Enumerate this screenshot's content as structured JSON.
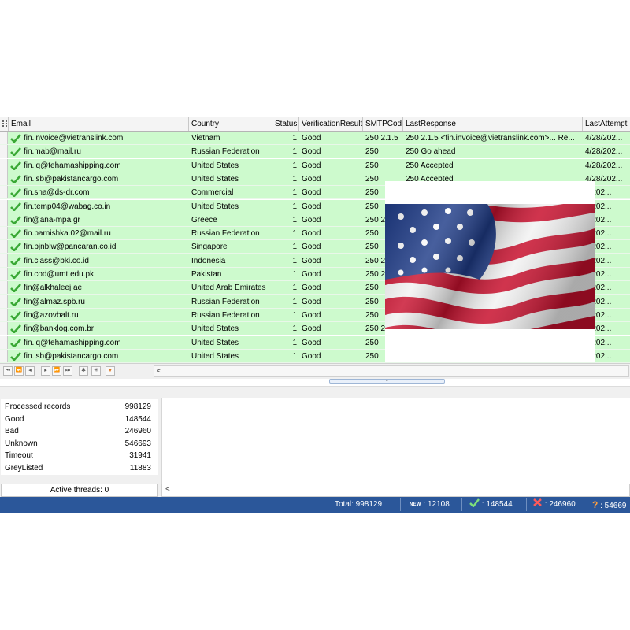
{
  "grid": {
    "columns": [
      {
        "label": "Email"
      },
      {
        "label": "Country"
      },
      {
        "label": "Status"
      },
      {
        "label": "VerificationResult"
      },
      {
        "label": "SMTPCode"
      },
      {
        "label": "LastResponse"
      },
      {
        "label": "LastAttempt"
      }
    ],
    "rows": [
      {
        "email": "fin.invoice@vietranslink.com",
        "country": "Vietnam",
        "status": "1",
        "result": "Good",
        "smtp": "250 2.1.5",
        "response": "250 2.1.5 <fin.invoice@vietranslink.com>... Re...",
        "attempt": "4/28/202..."
      },
      {
        "email": "fin.mab@mail.ru",
        "country": "Russian Federation",
        "status": "1",
        "result": "Good",
        "smtp": "250",
        "response": "250 Go ahead",
        "attempt": "4/28/202..."
      },
      {
        "email": "fin.iq@tehamashipping.com",
        "country": "United States",
        "status": "1",
        "result": "Good",
        "smtp": "250",
        "response": "250 Accepted",
        "attempt": "4/28/202..."
      },
      {
        "email": "fin.isb@pakistancargo.com",
        "country": "United States",
        "status": "1",
        "result": "Good",
        "smtp": "250",
        "response": "250 Accepted",
        "attempt": "4/28/202..."
      },
      {
        "email": "fin.sha@ds-dr.com",
        "country": "Commercial",
        "status": "1",
        "result": "Good",
        "smtp": "250",
        "response": "",
        "attempt": "8/202..."
      },
      {
        "email": "fin.temp04@wabag.co.in",
        "country": "United States",
        "status": "1",
        "result": "Good",
        "smtp": "250",
        "response": "",
        "attempt": "8/202..."
      },
      {
        "email": "fin@ana-mpa.gr",
        "country": "Greece",
        "status": "1",
        "result": "Good",
        "smtp": "250 2",
        "response": "",
        "attempt": "8/202..."
      },
      {
        "email": "fin.parnishka.02@mail.ru",
        "country": "Russian Federation",
        "status": "1",
        "result": "Good",
        "smtp": "250",
        "response": "",
        "attempt": "8/202..."
      },
      {
        "email": "fin.pjnblw@pancaran.co.id",
        "country": "Singapore",
        "status": "1",
        "result": "Good",
        "smtp": "250",
        "response": "",
        "attempt": "8/202..."
      },
      {
        "email": "fin.class@bki.co.id",
        "country": "Indonesia",
        "status": "1",
        "result": "Good",
        "smtp": "250 2",
        "response": "",
        "attempt": "8/202..."
      },
      {
        "email": "fin.cod@umt.edu.pk",
        "country": "Pakistan",
        "status": "1",
        "result": "Good",
        "smtp": "250 2",
        "response": "",
        "attempt": "8/202..."
      },
      {
        "email": "fin@alkhaleej.ae",
        "country": "United Arab Emirates",
        "status": "1",
        "result": "Good",
        "smtp": "250",
        "response": "",
        "attempt": "8/202..."
      },
      {
        "email": "fin@almaz.spb.ru",
        "country": "Russian Federation",
        "status": "1",
        "result": "Good",
        "smtp": "250",
        "response": "",
        "attempt": "8/202..."
      },
      {
        "email": "fin@azovbalt.ru",
        "country": "Russian Federation",
        "status": "1",
        "result": "Good",
        "smtp": "250",
        "response": "",
        "attempt": "8/202..."
      },
      {
        "email": "fin@banklog.com.br",
        "country": "United States",
        "status": "1",
        "result": "Good",
        "smtp": "250 2",
        "response": "",
        "attempt": "8/202..."
      },
      {
        "email": "fin.iq@tehamashipping.com",
        "country": "United States",
        "status": "1",
        "result": "Good",
        "smtp": "250",
        "response": "",
        "attempt": "8/202..."
      },
      {
        "email": "fin.isb@pakistancargo.com",
        "country": "United States",
        "status": "1",
        "result": "Good",
        "smtp": "250",
        "response": "",
        "attempt": "8/202..."
      }
    ]
  },
  "navigator": {
    "buttons": [
      "first-page",
      "prev-page",
      "prev-record",
      "next-record",
      "next-page",
      "last-page",
      "add-record",
      "refresh",
      "filter"
    ],
    "scroll_left": "<"
  },
  "splitter": {
    "glyph": "⌄"
  },
  "stats": [
    {
      "label": "Processed records",
      "value": "998129"
    },
    {
      "label": "Good",
      "value": "148544"
    },
    {
      "label": "Bad",
      "value": "246960"
    },
    {
      "label": "Unknown",
      "value": "546693"
    },
    {
      "label": "Timeout",
      "value": "31941"
    },
    {
      "label": "GreyListed",
      "value": "11883"
    }
  ],
  "threads": {
    "label": "Active threads: 0"
  },
  "log": {
    "scroll_left": "<"
  },
  "statusbar": {
    "total": "Total: 998129",
    "new_badge": "NEW",
    "new_value": ": 12108",
    "good_value": ": 148544",
    "bad_value": ": 246960",
    "unknown_value": ": 54669"
  },
  "colors": {
    "row_good": "#cdfacd",
    "statusbar": "#2b579a",
    "check": "#3aa835",
    "bad": "#d83a3a",
    "unknown": "#e0802a"
  },
  "icons": {
    "row_status": "check-icon",
    "status_good": "check-icon",
    "status_bad": "cross-icon",
    "status_unknown": "question-icon"
  }
}
